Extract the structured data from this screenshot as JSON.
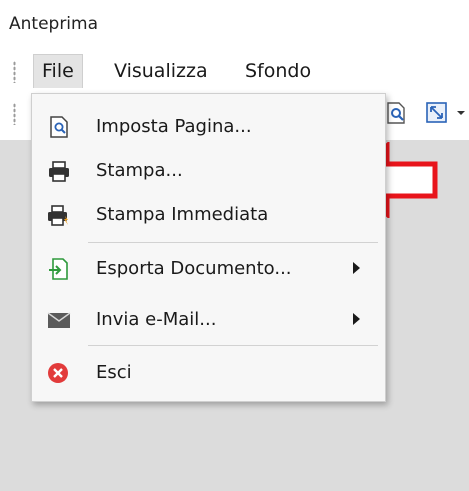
{
  "window": {
    "title": "Anteprima"
  },
  "menubar": {
    "items": [
      {
        "label": "File",
        "active": true
      },
      {
        "label": "Visualizza"
      },
      {
        "label": "Sfondo"
      }
    ]
  },
  "toolbar": {
    "icons": [
      "magnifier-page-icon",
      "fit-window-icon"
    ]
  },
  "file_menu": {
    "items": [
      {
        "label": "Imposta Pagina...",
        "icon": "page-setup-icon"
      },
      {
        "label": "Stampa...",
        "icon": "printer-icon"
      },
      {
        "label": "Stampa Immediata",
        "icon": "quick-print-icon"
      },
      {
        "label": "Esporta Documento...",
        "icon": "export-icon",
        "submenu": true
      },
      {
        "label": "Invia e-Mail...",
        "icon": "mail-icon",
        "submenu": true
      },
      {
        "label": "Esci",
        "icon": "exit-icon"
      }
    ]
  },
  "colors": {
    "annotation_arrow": "#e8141b",
    "exit_icon": "#e23b3b",
    "export_icon": "#2e9a3c",
    "accent_blue": "#2a63b7"
  }
}
